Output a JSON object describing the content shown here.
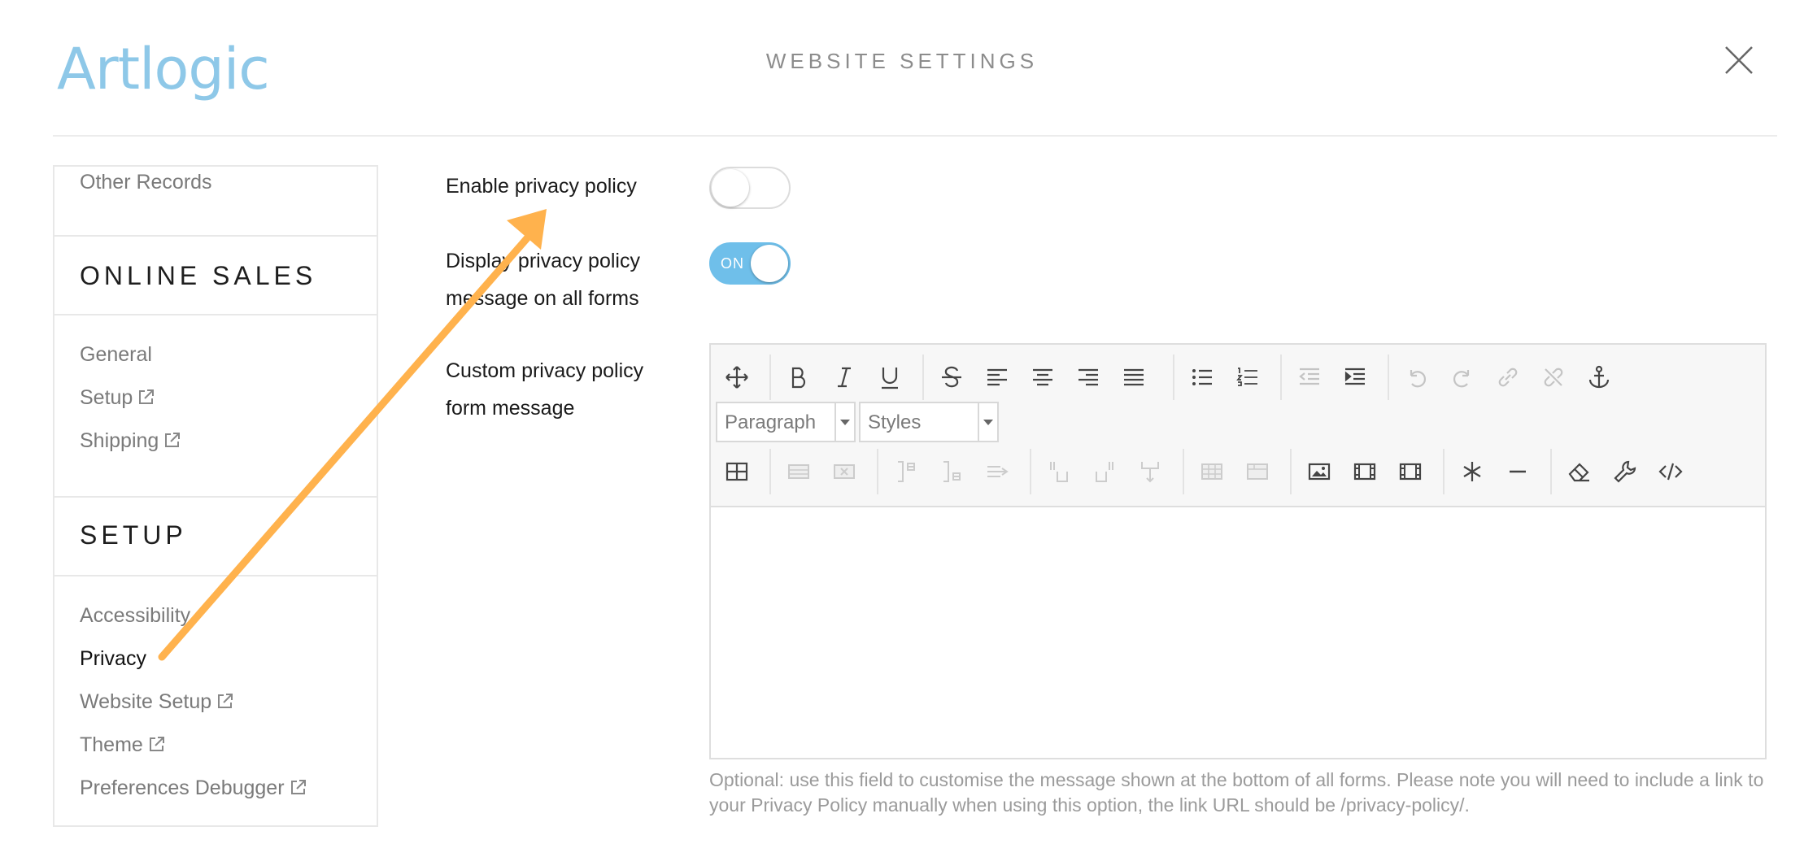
{
  "header": {
    "logo": "Artlogic",
    "title": "WEBSITE SETTINGS"
  },
  "sidebar": {
    "top_item": "Other Records",
    "online_sales": {
      "heading": "ONLINE SALES",
      "items": [
        {
          "label": "General",
          "external": false
        },
        {
          "label": "Setup",
          "external": true
        },
        {
          "label": "Shipping",
          "external": true
        }
      ]
    },
    "setup": {
      "heading": "SETUP",
      "items": [
        {
          "label": "Accessibility",
          "external": false
        },
        {
          "label": "Privacy",
          "external": false,
          "active": true
        },
        {
          "label": "Website Setup",
          "external": true
        },
        {
          "label": "Theme",
          "external": true
        },
        {
          "label": "Preferences Debugger",
          "external": true
        }
      ]
    }
  },
  "settings": {
    "enable_privacy": {
      "label": "Enable privacy policy",
      "state": "off"
    },
    "display_message": {
      "label": "Display privacy policy message on all forms",
      "state": "on",
      "toggle_text": "ON"
    },
    "custom_message": {
      "label": "Custom privacy policy form message"
    }
  },
  "editor": {
    "format_select": "Paragraph",
    "styles_select": "Styles",
    "content": ""
  },
  "help_text": "Optional: use this field to customise the message shown at the bottom of all forms. Please note you will need to include a link to your Privacy Policy manually when using this option, the link URL should be /privacy-policy/.",
  "colors": {
    "accent": "#6fbfea",
    "logo": "#8ec8e8",
    "annotation_arrow": "#ffb24d"
  }
}
